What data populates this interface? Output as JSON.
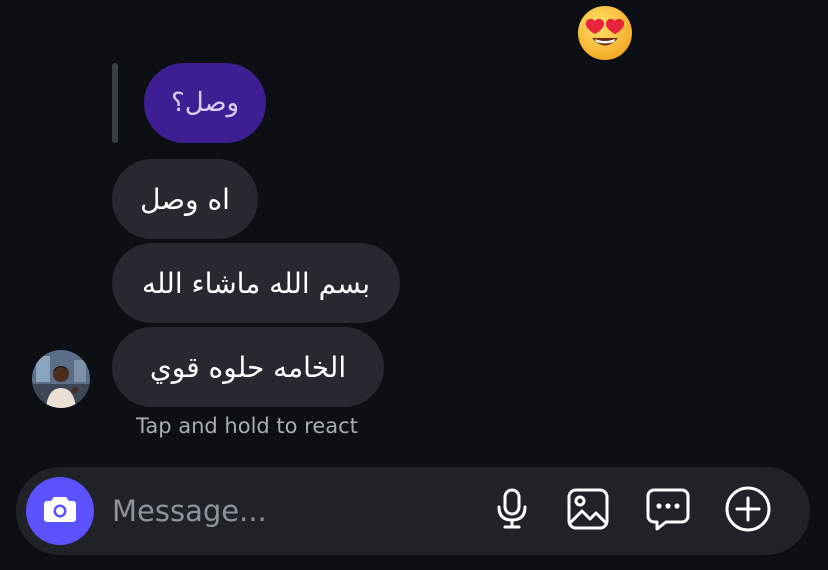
{
  "reaction": {
    "emoji": "😍",
    "icon": "heart-eyes-emoji-icon"
  },
  "thread": {
    "reply_quote": {
      "text": "وصل؟",
      "color": "#3e1f93"
    },
    "messages": [
      {
        "text": "اه وصل"
      },
      {
        "text": "بسم الله ماشاء الله"
      },
      {
        "text": "الخامه حلوه قوي"
      }
    ],
    "hint": "Tap and hold to react"
  },
  "composer": {
    "placeholder": "Message...",
    "value": "",
    "accent": "#5b51ff",
    "icons": [
      "camera-icon",
      "microphone-icon",
      "gallery-icon",
      "sticker-icon",
      "add-icon"
    ]
  }
}
